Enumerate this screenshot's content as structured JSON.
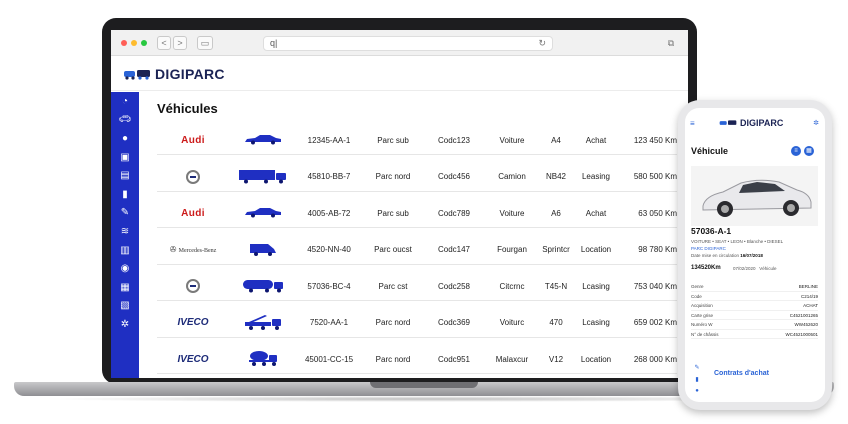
{
  "browser": {
    "url": "q|",
    "back": "<",
    "forward": ">"
  },
  "app": {
    "name": "DIGIPARC"
  },
  "page": {
    "title": "Véhicules"
  },
  "sidebar": {
    "icons": [
      "dashboard-icon",
      "car-icon",
      "driver-icon",
      "building-icon",
      "document-icon",
      "fuel-icon",
      "wrench-icon",
      "layers-icon",
      "sites-icon",
      "location-pin-icon",
      "bus-icon",
      "report-icon",
      "settings-icon"
    ]
  },
  "vehicles": [
    {
      "brand": "Audi",
      "brand_style": "audi",
      "vehicle_icon": "sedan-icon",
      "plate": "12345-AA-1",
      "site": "Parc sub",
      "code": "Codc123",
      "type": "Voiture",
      "model": "A4",
      "mode": "Achat",
      "km": "123 450 Km"
    },
    {
      "brand": "Volvo",
      "brand_style": "volvo",
      "vehicle_icon": "truck-trailer-icon",
      "plate": "45810-BB-7",
      "site": "Parc nord",
      "code": "Codc456",
      "type": "Camion",
      "model": "NB42",
      "mode": "Leasing",
      "km": "580 500 Km"
    },
    {
      "brand": "Audi",
      "brand_style": "audi",
      "vehicle_icon": "sedan-icon",
      "plate": "4005-AB-72",
      "site": "Parc sub",
      "code": "Codc789",
      "type": "Voiture",
      "model": "A6",
      "mode": "Achat",
      "km": "63 050 Km"
    },
    {
      "brand": "Mercedes-Benz",
      "brand_style": "merc",
      "vehicle_icon": "van-icon",
      "plate": "4520-NN-40",
      "site": "Parc oucst",
      "code": "Codc147",
      "type": "Fourgan",
      "model": "Sprintcr",
      "mode": "Location",
      "km": "98 780 Km"
    },
    {
      "brand": "Volvo",
      "brand_style": "volvo",
      "vehicle_icon": "tanker-icon",
      "plate": "57036-BC-4",
      "site": "Parc cst",
      "code": "Codc258",
      "type": "Citcrnc",
      "model": "T45-N",
      "mode": "Lcasing",
      "km": "753 040 Km"
    },
    {
      "brand": "IVECO",
      "brand_style": "iveco",
      "vehicle_icon": "crane-truck-icon",
      "plate": "7520-AA-1",
      "site": "Parc nord",
      "code": "Codc369",
      "type": "Voiturc",
      "model": "470",
      "mode": "Lcasing",
      "km": "659 002 Km"
    },
    {
      "brand": "IVECO",
      "brand_style": "iveco",
      "vehicle_icon": "mixer-truck-icon",
      "plate": "45001-CC-15",
      "site": "Parc nord",
      "code": "Codc951",
      "type": "Malaxcur",
      "model": "V12",
      "mode": "Location",
      "km": "268 000 Km"
    }
  ],
  "phone": {
    "app_name": "DIGIPARC",
    "title": "Véhicule",
    "plate": "57036-A-1",
    "subtitle": "VOITURE • SEAT • LEON • Blanche • DIESEL",
    "park": "PARC DIGIPARC",
    "date_label": "Date mise en circulation",
    "date_value": "16/07/2018",
    "km": "134520Km",
    "km_date": "07/02/2020",
    "km_source": "Véhicule",
    "details": [
      {
        "label": "Genre",
        "value": "BERLINE"
      },
      {
        "label": "Code",
        "value": "C214/19"
      },
      {
        "label": "Acquisition",
        "value": "ACHAT"
      },
      {
        "label": "Carte grise",
        "value": "C4521001265"
      },
      {
        "label": "Numéro W",
        "value": "WW452620"
      },
      {
        "label": "N° de châssis",
        "value": "WC4521000501"
      }
    ],
    "contracts_label": "Contrats d'achat"
  },
  "colors": {
    "sidebar": "#1f2fc2",
    "accent": "#2a63d6",
    "brand_dark": "#1b2354"
  }
}
